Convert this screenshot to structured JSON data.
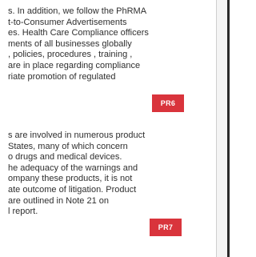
{
  "paragraphs": [
    {
      "lines": [
        "s. In addition, we follow the PhRMA",
        "t-to-Consumer Advertisements",
        "es. Health Care Compliance officers",
        "ments of all businesses globally",
        ", policies, procedures , training ,",
        "are in place regarding  compliance",
        "riate promotion of regulated"
      ]
    },
    {
      "lines": [
        "s are involved in numerous product",
        "States, many of which concern",
        "o drugs and medical devices.",
        "he adequacy of the warnings and",
        "ompany these products, it is not",
        "ate outcome of litigation. Product",
        "are outlined in Note 21 on",
        "l report."
      ]
    }
  ],
  "tags": [
    {
      "label": "PR6",
      "color": "#d9343c"
    },
    {
      "label": "PR7",
      "color": "#d9343c"
    }
  ]
}
